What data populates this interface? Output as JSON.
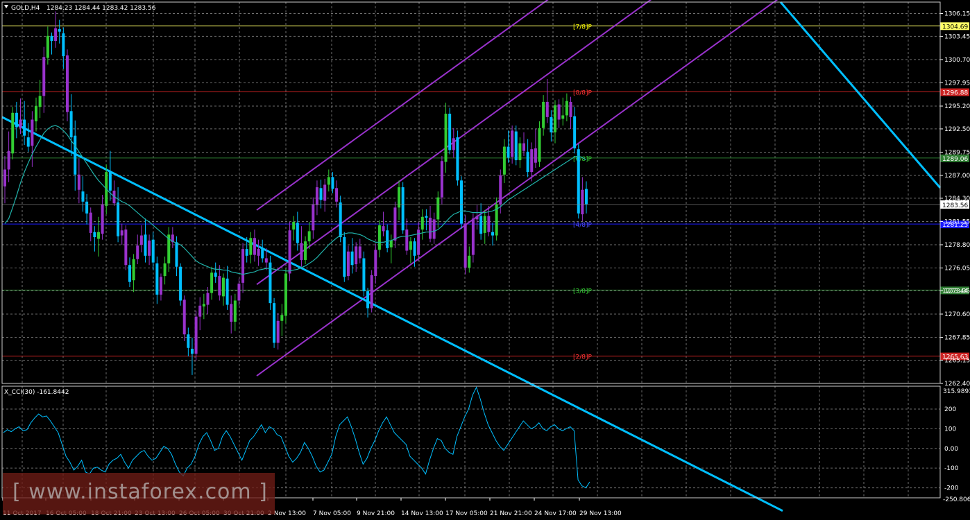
{
  "header": {
    "symbol": "GOLD,H4",
    "ohlc": "1284.23 1284.44 1283.42 1283.56"
  },
  "indicator": {
    "label": "X_CCI(30) -161.8442",
    "scale_top": "315.9893",
    "scale_bottom": "-250.8065",
    "ticks": [
      "200",
      "100",
      "0.00",
      "-100",
      "-200"
    ]
  },
  "watermark": "[ www.instaforex.com ]",
  "colors": {
    "background": "#000000",
    "grid": "#6e6e6e",
    "bull_candle": "#32cd32",
    "bear_candle": "#00bfff",
    "purple_candle": "#9932cc",
    "ma_line": "#20b2aa",
    "channel": "#9932cc",
    "trendline": "#00bfff",
    "cci_line": "#00bfff"
  },
  "chart_data": {
    "type": "candlestick",
    "title": "GOLD,H4",
    "ylim": [
      1262.4,
      1307.5
    ],
    "y_ticks": [
      "1306.15",
      "1303.45",
      "1300.70",
      "1297.95",
      "1295.20",
      "1292.50",
      "1289.75",
      "1287.00",
      "1284.30",
      "1281.55",
      "1278.80",
      "1276.05",
      "1273.35",
      "1270.60",
      "1267.85",
      "1265.15",
      "1262.40"
    ],
    "x_ticks": [
      "11 Oct 2017",
      "16 Oct 05:00",
      "18 Oct 21:00",
      "23 Oct 13:00",
      "26 Oct 05:00",
      "30 Oct 21:00",
      "2 Nov 13:00",
      "7 Nov 05:00",
      "9 Nov 21:00",
      "14 Nov 13:00",
      "17 Nov 05:00",
      "21 Nov 21:00",
      "24 Nov 17:00",
      "29 Nov 13:00"
    ],
    "current_price": "1283.56",
    "levels": [
      {
        "price": 1304.69,
        "label": "1304.69",
        "tag": "[7/8]P",
        "color": "#ffff66",
        "tag_color": "#ffff00"
      },
      {
        "price": 1296.88,
        "label": "1296.88",
        "tag": "[8/8]P",
        "color": "#cc2222",
        "tag_color": "#ff3333"
      },
      {
        "price": 1289.06,
        "label": "1289.06",
        "tag": "[6/8]P",
        "color": "#2e7d32",
        "tag_color": "#33cc33"
      },
      {
        "price": 1281.25,
        "label": "1281.25",
        "tag": "[4/8]P",
        "color": "#1a1aff",
        "tag_color": "#4d4dff"
      },
      {
        "price": 1273.44,
        "label": "1273.44",
        "tag": "[3/8]P",
        "color": "#2e7d32",
        "tag_color": "#33cc33"
      },
      {
        "price": 1265.63,
        "label": "1265.63",
        "tag": "[2/8]P",
        "color": "#cc2222",
        "tag_color": "#ff3333"
      }
    ],
    "candles": [
      [
        1285.7,
        1289.3,
        1283.7,
        1287.7
      ],
      [
        1287.7,
        1292.2,
        1286.2,
        1289.9
      ],
      [
        1289.6,
        1295.1,
        1288.9,
        1294.4
      ],
      [
        1294.4,
        1295.7,
        1291.4,
        1292.7
      ],
      [
        1292.6,
        1296.1,
        1291.9,
        1293.6
      ],
      [
        1293.6,
        1295.8,
        1290.6,
        1291.7
      ],
      [
        1291.5,
        1293.2,
        1289.8,
        1290.4
      ],
      [
        1290.5,
        1294.6,
        1288.0,
        1293.6
      ],
      [
        1293.4,
        1296.2,
        1292.2,
        1295.2
      ],
      [
        1295.1,
        1298.3,
        1293.8,
        1296.4
      ],
      [
        1296.4,
        1302.2,
        1294.4,
        1301.0
      ],
      [
        1300.9,
        1304.6,
        1300.1,
        1303.5
      ],
      [
        1303.5,
        1303.9,
        1301.3,
        1302.9
      ],
      [
        1302.9,
        1306.4,
        1302.1,
        1304.4
      ],
      [
        1304.3,
        1305.4,
        1302.6,
        1304.0
      ],
      [
        1303.8,
        1304.5,
        1299.6,
        1301.1
      ],
      [
        1301.2,
        1301.9,
        1293.4,
        1294.5
      ],
      [
        1294.6,
        1296.6,
        1289.3,
        1291.5
      ],
      [
        1291.7,
        1293.5,
        1285.2,
        1287.1
      ],
      [
        1287.1,
        1289.0,
        1283.7,
        1285.3
      ],
      [
        1285.1,
        1286.9,
        1282.7,
        1283.9
      ],
      [
        1283.9,
        1284.8,
        1281.2,
        1282.5
      ],
      [
        1282.6,
        1283.2,
        1279.2,
        1280.2
      ],
      [
        1280.3,
        1281.0,
        1278.0,
        1279.7
      ],
      [
        1279.5,
        1282.1,
        1277.4,
        1280.3
      ],
      [
        1280.1,
        1284.7,
        1279.4,
        1283.6
      ],
      [
        1283.4,
        1288.3,
        1282.4,
        1287.4
      ],
      [
        1287.4,
        1289.9,
        1284.0,
        1285.2
      ],
      [
        1285.2,
        1286.4,
        1283.4,
        1283.7
      ],
      [
        1283.8,
        1285.6,
        1279.1,
        1279.8
      ],
      [
        1279.9,
        1281.3,
        1278.8,
        1280.5
      ],
      [
        1280.6,
        1281.1,
        1275.8,
        1276.4
      ],
      [
        1276.4,
        1277.3,
        1273.8,
        1274.4
      ],
      [
        1274.6,
        1277.7,
        1273.2,
        1277.1
      ],
      [
        1277.1,
        1280.0,
        1276.5,
        1278.7
      ],
      [
        1278.8,
        1281.1,
        1277.9,
        1279.9
      ],
      [
        1280.0,
        1281.9,
        1276.7,
        1277.5
      ],
      [
        1277.5,
        1280.0,
        1276.4,
        1279.3
      ],
      [
        1279.4,
        1280.3,
        1275.8,
        1276.7
      ],
      [
        1276.6,
        1277.4,
        1271.8,
        1272.9
      ],
      [
        1272.9,
        1275.4,
        1272.2,
        1275.0
      ],
      [
        1275.1,
        1277.4,
        1274.1,
        1276.6
      ],
      [
        1276.6,
        1280.9,
        1275.6,
        1280.0
      ],
      [
        1280.0,
        1280.9,
        1278.4,
        1279.1
      ],
      [
        1279.1,
        1279.8,
        1275.1,
        1276.2
      ],
      [
        1276.2,
        1276.6,
        1271.6,
        1272.2
      ],
      [
        1272.3,
        1272.8,
        1267.4,
        1268.2
      ],
      [
        1268.2,
        1269.0,
        1265.6,
        1266.6
      ],
      [
        1266.5,
        1267.8,
        1263.4,
        1265.9
      ],
      [
        1265.9,
        1271.0,
        1265.1,
        1270.3
      ],
      [
        1270.3,
        1272.6,
        1268.7,
        1271.6
      ],
      [
        1271.5,
        1273.0,
        1270.0,
        1271.8
      ],
      [
        1271.7,
        1273.8,
        1270.6,
        1273.1
      ],
      [
        1273.1,
        1276.2,
        1272.3,
        1275.5
      ],
      [
        1275.5,
        1276.7,
        1274.3,
        1275.0
      ],
      [
        1275.1,
        1276.4,
        1272.2,
        1272.8
      ],
      [
        1272.7,
        1275.4,
        1271.6,
        1274.9
      ],
      [
        1274.8,
        1276.3,
        1271.1,
        1271.7
      ],
      [
        1271.8,
        1272.8,
        1268.3,
        1269.7
      ],
      [
        1269.7,
        1273.0,
        1268.6,
        1272.2
      ],
      [
        1272.2,
        1274.8,
        1271.6,
        1274.2
      ],
      [
        1274.3,
        1279.0,
        1273.1,
        1278.3
      ],
      [
        1278.3,
        1279.7,
        1276.7,
        1277.5
      ],
      [
        1277.6,
        1280.3,
        1276.6,
        1279.6
      ],
      [
        1279.6,
        1280.6,
        1276.8,
        1277.6
      ],
      [
        1277.5,
        1279.4,
        1276.3,
        1278.3
      ],
      [
        1278.3,
        1279.4,
        1276.7,
        1277.2
      ],
      [
        1277.2,
        1278.4,
        1275.8,
        1276.7
      ],
      [
        1276.7,
        1277.5,
        1271.1,
        1271.9
      ],
      [
        1271.9,
        1272.5,
        1266.6,
        1267.2
      ],
      [
        1267.2,
        1270.7,
        1266.4,
        1269.8
      ],
      [
        1269.8,
        1271.8,
        1268.0,
        1270.5
      ],
      [
        1270.4,
        1276.0,
        1269.5,
        1275.4
      ],
      [
        1275.4,
        1281.5,
        1274.5,
        1280.5
      ],
      [
        1280.6,
        1282.2,
        1279.3,
        1281.5
      ],
      [
        1281.4,
        1282.7,
        1278.1,
        1279.0
      ],
      [
        1279.0,
        1281.0,
        1276.2,
        1277.0
      ],
      [
        1277.0,
        1279.8,
        1276.5,
        1279.2
      ],
      [
        1279.2,
        1281.5,
        1278.3,
        1280.4
      ],
      [
        1280.5,
        1284.4,
        1279.5,
        1283.6
      ],
      [
        1283.5,
        1286.4,
        1282.3,
        1285.6
      ],
      [
        1285.5,
        1286.5,
        1283.1,
        1284.1
      ],
      [
        1284.0,
        1286.6,
        1282.7,
        1285.9
      ],
      [
        1285.9,
        1287.7,
        1285.1,
        1286.8
      ],
      [
        1286.8,
        1287.4,
        1284.9,
        1285.4
      ],
      [
        1285.5,
        1286.4,
        1283.2,
        1283.9
      ],
      [
        1283.8,
        1284.6,
        1279.1,
        1279.7
      ],
      [
        1279.7,
        1280.3,
        1274.4,
        1275.0
      ],
      [
        1275.1,
        1278.7,
        1274.6,
        1278.0
      ],
      [
        1278.0,
        1279.6,
        1275.4,
        1276.4
      ],
      [
        1276.5,
        1279.1,
        1275.6,
        1278.6
      ],
      [
        1278.6,
        1279.5,
        1276.6,
        1277.2
      ],
      [
        1277.2,
        1278.0,
        1272.7,
        1273.3
      ],
      [
        1273.3,
        1273.7,
        1270.2,
        1271.3
      ],
      [
        1271.3,
        1275.8,
        1270.8,
        1275.2
      ],
      [
        1275.1,
        1278.9,
        1274.2,
        1278.2
      ],
      [
        1278.2,
        1281.7,
        1277.3,
        1281.1
      ],
      [
        1281.0,
        1282.7,
        1279.8,
        1280.4
      ],
      [
        1280.5,
        1281.2,
        1277.9,
        1278.4
      ],
      [
        1278.5,
        1280.0,
        1276.6,
        1279.3
      ],
      [
        1279.3,
        1283.9,
        1278.4,
        1283.2
      ],
      [
        1283.2,
        1286.4,
        1281.7,
        1285.6
      ],
      [
        1285.6,
        1286.2,
        1280.1,
        1280.5
      ],
      [
        1280.6,
        1281.9,
        1277.6,
        1278.1
      ],
      [
        1278.2,
        1279.7,
        1276.6,
        1279.2
      ],
      [
        1279.2,
        1279.6,
        1276.2,
        1277.5
      ],
      [
        1277.6,
        1281.5,
        1276.9,
        1280.6
      ],
      [
        1280.6,
        1283.0,
        1279.4,
        1282.1
      ],
      [
        1282.2,
        1283.0,
        1280.5,
        1282.0
      ],
      [
        1282.0,
        1283.4,
        1279.1,
        1279.5
      ],
      [
        1279.5,
        1282.6,
        1278.9,
        1281.8
      ],
      [
        1281.8,
        1285.1,
        1280.8,
        1284.4
      ],
      [
        1284.4,
        1289.3,
        1283.6,
        1288.7
      ],
      [
        1288.6,
        1295.6,
        1287.3,
        1294.3
      ],
      [
        1294.3,
        1295.0,
        1289.5,
        1290.0
      ],
      [
        1290.0,
        1292.6,
        1289.1,
        1291.4
      ],
      [
        1291.5,
        1292.3,
        1285.8,
        1286.4
      ],
      [
        1286.4,
        1286.9,
        1280.7,
        1281.3
      ],
      [
        1281.3,
        1282.3,
        1275.3,
        1276.1
      ],
      [
        1276.1,
        1278.6,
        1275.5,
        1277.5
      ],
      [
        1277.6,
        1282.5,
        1276.7,
        1281.9
      ],
      [
        1281.8,
        1283.5,
        1280.6,
        1282.2
      ],
      [
        1282.2,
        1283.7,
        1279.4,
        1280.1
      ],
      [
        1280.2,
        1282.9,
        1278.9,
        1282.2
      ],
      [
        1282.2,
        1283.4,
        1279.8,
        1280.3
      ],
      [
        1280.3,
        1281.4,
        1278.7,
        1279.9
      ],
      [
        1279.9,
        1284.4,
        1279.3,
        1283.6
      ],
      [
        1283.6,
        1287.7,
        1282.5,
        1287.0
      ],
      [
        1287.1,
        1291.3,
        1286.1,
        1290.4
      ],
      [
        1290.4,
        1292.3,
        1288.5,
        1289.1
      ],
      [
        1289.2,
        1292.9,
        1288.4,
        1292.3
      ],
      [
        1292.2,
        1292.9,
        1288.2,
        1288.8
      ],
      [
        1288.8,
        1291.5,
        1287.9,
        1290.8
      ],
      [
        1290.8,
        1292.1,
        1289.3,
        1289.9
      ],
      [
        1289.8,
        1291.3,
        1286.8,
        1287.4
      ],
      [
        1287.4,
        1290.9,
        1286.3,
        1290.1
      ],
      [
        1290.2,
        1292.5,
        1287.9,
        1288.5
      ],
      [
        1288.6,
        1293.4,
        1288.0,
        1292.6
      ],
      [
        1292.6,
        1296.5,
        1291.7,
        1295.7
      ],
      [
        1295.7,
        1298.4,
        1293.2,
        1293.9
      ],
      [
        1293.9,
        1294.7,
        1291.0,
        1292.1
      ],
      [
        1292.1,
        1295.9,
        1290.8,
        1295.3
      ],
      [
        1295.4,
        1296.0,
        1292.6,
        1293.6
      ],
      [
        1293.7,
        1296.2,
        1292.9,
        1294.1
      ],
      [
        1294.1,
        1296.7,
        1293.4,
        1295.8
      ],
      [
        1295.7,
        1296.3,
        1292.5,
        1293.9
      ],
      [
        1294.0,
        1295.1,
        1289.6,
        1290.2
      ],
      [
        1290.1,
        1290.7,
        1281.9,
        1282.5
      ],
      [
        1282.4,
        1286.8,
        1281.6,
        1285.3
      ],
      [
        1285.4,
        1286.3,
        1282.5,
        1283.6
      ]
    ],
    "ma_line": [
      1281.3,
      1281.9,
      1283.2,
      1284.6,
      1286.1,
      1287.4,
      1288.5,
      1289.5,
      1290.4,
      1291.2,
      1292.0,
      1292.5,
      1292.8,
      1292.9,
      1292.7,
      1292.3,
      1291.8,
      1291.1,
      1290.5,
      1289.8,
      1289.1,
      1288.4,
      1287.7,
      1287.0,
      1286.4,
      1285.9,
      1285.4,
      1284.9,
      1284.5,
      1284.2,
      1283.9,
      1283.7,
      1283.4,
      1283.0,
      1282.6,
      1282.2,
      1281.8,
      1281.5,
      1281.1,
      1280.7,
      1280.3,
      1279.9,
      1279.5,
      1279.2,
      1279.0,
      1278.8,
      1278.4,
      1277.9,
      1277.4,
      1276.9,
      1276.6,
      1276.4,
      1276.2,
      1276.0,
      1275.9,
      1275.9,
      1275.8,
      1275.8,
      1275.6,
      1275.5,
      1275.4,
      1275.3,
      1275.4,
      1275.5,
      1275.6,
      1275.8,
      1275.9,
      1276.0,
      1276.0,
      1275.9,
      1275.8,
      1275.8,
      1275.7,
      1275.7,
      1275.8,
      1275.9,
      1276.1,
      1276.3,
      1276.6,
      1276.9,
      1277.3,
      1277.8,
      1278.3,
      1278.8,
      1279.2,
      1279.6,
      1279.9,
      1280.1,
      1280.2,
      1280.2,
      1280.1,
      1280.0,
      1279.8,
      1279.5,
      1279.3,
      1279.1,
      1279.1,
      1279.1,
      1279.2,
      1279.3,
      1279.5,
      1279.7,
      1279.8,
      1279.8,
      1279.9,
      1280.0,
      1280.1,
      1280.2,
      1280.3,
      1280.3,
      1280.4,
      1280.6,
      1281.0,
      1281.5,
      1282.0,
      1282.4,
      1282.6,
      1282.8,
      1282.8,
      1282.7,
      1282.6,
      1282.6,
      1282.6,
      1282.6,
      1282.7,
      1282.8,
      1283.0,
      1283.3,
      1283.7,
      1284.1,
      1284.4,
      1284.7,
      1285.0,
      1285.3,
      1285.6,
      1285.9,
      1286.2,
      1286.5,
      1286.8,
      1287.1,
      1287.4,
      1287.7,
      1288.0,
      1288.3,
      1288.6,
      1288.9,
      1289.2,
      1289.3,
      1289.1,
      1288.8
    ],
    "cci": [
      80,
      95,
      85,
      100,
      110,
      90,
      95,
      130,
      155,
      175,
      160,
      165,
      140,
      110,
      80,
      20,
      -40,
      -70,
      -110,
      -90,
      -60,
      -120,
      -130,
      -100,
      -95,
      -110,
      -120,
      -80,
      -60,
      -50,
      -30,
      -70,
      -100,
      -60,
      -40,
      -20,
      -10,
      -40,
      -60,
      -50,
      -20,
      10,
      0,
      -30,
      -80,
      -120,
      -140,
      -100,
      -80,
      -40,
      20,
      60,
      80,
      40,
      -10,
      0,
      60,
      90,
      60,
      20,
      -20,
      -60,
      -10,
      40,
      60,
      90,
      120,
      80,
      110,
      100,
      70,
      60,
      10,
      -40,
      -70,
      -50,
      -20,
      30,
      0,
      -40,
      -90,
      -120,
      -110,
      -70,
      -30,
      60,
      120,
      140,
      160,
      110,
      50,
      -20,
      -80,
      -50,
      0,
      40,
      90,
      130,
      160,
      120,
      80,
      60,
      40,
      20,
      -40,
      -60,
      -80,
      -100,
      -130,
      -60,
      0,
      50,
      40,
      0,
      -20,
      -30,
      60,
      110,
      160,
      200,
      270,
      310,
      250,
      180,
      120,
      80,
      40,
      10,
      -10,
      20,
      50,
      80,
      110,
      140,
      120,
      100,
      110,
      130,
      100,
      90,
      110,
      120,
      100,
      90,
      100,
      110,
      90,
      -160,
      -190,
      -200,
      -170
    ],
    "cci_ylim": [
      -250.8065,
      315.9893
    ],
    "channel_slope_per_px": 0.0593,
    "trendline_slope_per_px": -0.0414
  }
}
